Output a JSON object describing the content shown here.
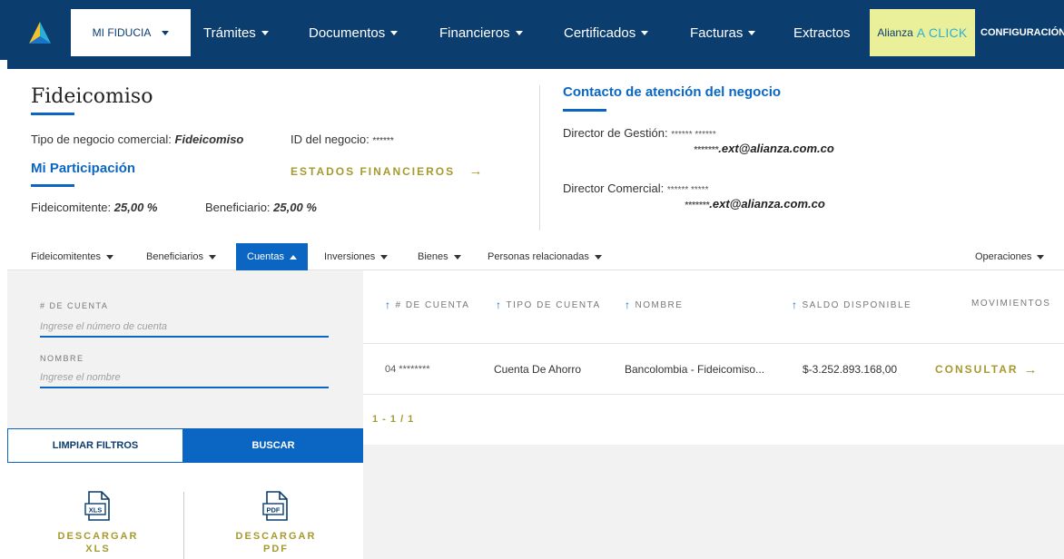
{
  "nav": {
    "mi_fiducia": "MI FIDUCIA",
    "tramites": "Trámites",
    "documentos": "Documentos",
    "financieros": "Financieros",
    "certificados": "Certificados",
    "facturas": "Facturas",
    "extractos": "Extractos",
    "aclick_prefix": "Alianza",
    "aclick_brand": "A CLICK",
    "configuracion": "CONFIGURACIÓN"
  },
  "business": {
    "title": "Fideicomiso",
    "tipo_label": "Tipo de negocio comercial:",
    "tipo_value": "Fideicomiso",
    "id_label": "ID del negocio:",
    "id_value": "******",
    "participacion_title": "Mi Participación",
    "estados_link": "ESTADOS FINANCIEROS",
    "fideicomitente_label": "Fideicomitente:",
    "fideicomitente_value": "25,00 %",
    "beneficiario_label": "Beneficiario:",
    "beneficiario_value": "25,00 %"
  },
  "contact": {
    "title": "Contacto de atención del negocio",
    "gestion_label": "Director de Gestión:",
    "gestion_name": "****** ******",
    "gestion_email_mask": "*******",
    "gestion_email": ".ext@alianza.com.co",
    "comercial_label": "Director Comercial:",
    "comercial_name": "****** *****",
    "comercial_email_mask": "*******",
    "comercial_email": ".ext@alianza.com.co"
  },
  "tabs": {
    "fideicomitentes": "Fideicomitentes",
    "beneficiarios": "Beneficiarios",
    "cuentas": "Cuentas",
    "inversiones": "Inversiones",
    "bienes": "Bienes",
    "personas": "Personas relacionadas",
    "operaciones": "Operaciones"
  },
  "filters": {
    "cuenta_label": "# DE CUENTA",
    "cuenta_placeholder": "Ingrese el número de cuenta",
    "nombre_label": "NOMBRE",
    "nombre_placeholder": "Ingrese el nombre",
    "limpiar": "LIMPIAR FILTROS",
    "buscar": "BUSCAR",
    "descargar_xls_1": "DESCARGAR",
    "descargar_xls_2": "XLS",
    "descargar_pdf_1": "DESCARGAR",
    "descargar_pdf_2": "PDF",
    "xls_badge": "XLS",
    "pdf_badge": "PDF"
  },
  "table": {
    "headers": {
      "cuenta": "# DE CUENTA",
      "tipo": "TIPO DE CUENTA",
      "nombre": "NOMBRE",
      "saldo": "SALDO DISPONIBLE",
      "movimientos": "MOVIMIENTOS"
    },
    "rows": [
      {
        "cuenta": "04 ********",
        "tipo": "Cuenta De Ahorro",
        "nombre": "Bancolombia - Fideicomiso...",
        "saldo": "$-3.252.893.168,00",
        "accion": "CONSULTAR"
      }
    ],
    "pagination": "1 - 1 / 1"
  },
  "colors": {
    "navy": "#0b3d6e",
    "primary": "#0a66c2",
    "gold": "#a69a2e",
    "aclick_bg": "#eaf09a"
  }
}
